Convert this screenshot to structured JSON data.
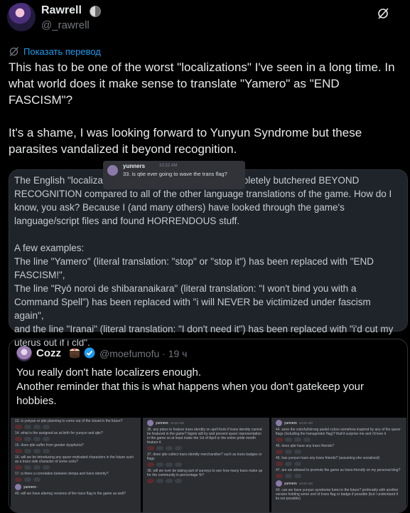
{
  "author": {
    "name": "Rawrell",
    "handle": "@_rawrell",
    "name_emoji_icon": "moon-icon"
  },
  "icons": {
    "top_right": "grok-slash-icon",
    "translate": "grok-icon"
  },
  "translate_link": "Показать перевод",
  "tweet_text": "This has to be one of the worst \"localizations\" I've seen in a long time. In what world does it make sense to translate \"Yamero\" as \"END FASCISM\"?\n\nIt's a shame, I was looking forward to Yunyun Syndrome but these parasites vandalized it beyond recognition.",
  "screenshot_text": "The English \"localization\" for this game has been completely butchered BEYOND RECOGNITION compared to all of the other language translations of the game. How do I know, you ask? Because I (and many others) have looked through the game's language/script files and found HORRENDOUS stuff.\n\nA few examples:\nThe line \"Yamero\" (literal translation: \"stop\" or \"stop it\") has been replaced with \"END FASCISM!\",\nThe line \"Ryō noroi de shibaranaikara\" (literal translation: \"I won't bind you with a Command Spell\") has been replaced with \"i will NEVER be victimized under fascism again\",\nand the line \"Iranai\" (literal translation: \"I don't need it\") has been replaced with \"i'd cut my uterus out if i cld\".",
  "quote": {
    "name": "Cozz",
    "handle_time": "@moefumofu · 19 ч",
    "text": "You really don't hate localizers enough.\nAnother reminder that this is what happens when you don't gatekeep your hobbies.",
    "name_emoji_icon": "cake-icon",
    "badge_icon": "verified-badge-icon"
  },
  "media": {
    "panel1": {
      "messages": [
        "13. is yunyun or qtie planning to come out of the closet in the future?",
        "14. what is the assigned as at birth for yunyun and qtie?",
        "15. does qtie suffer from gender dysphoria?",
        "16. will we be introducing any queer motivated characters in the future such as a trans side character of some sorts?",
        "17. is there a correlation between denpa and trans identity?"
      ],
      "trailing": "yunners ·",
      "trailing_msg": "40. will we have altering versions of the trans flag in the game as well?"
    },
    "panel2": {
      "poster": "yunners",
      "time": "10:22 AM",
      "messages": [
        "36. any plans to feature trans identity on april fools if trans identity cannot be featured in the game? bigots will try and prevent queer representation in the game so at least make the 1st of April or the entire pride month feature it",
        "37. does qtie collect trans identity merchandise? such as trans badges or flags",
        "38. will we ever be taking part of surveys to see how many trans make up for the community in percentage %?"
      ]
    },
    "panel3": {
      "poster": "yunners",
      "time": "10:22 AM",
      "messages": [
        "44. were the colorful/strong pastel colors somehow inspired by any of the queer flags (including the transgender flag)? that'd surprise me and i'd love it",
        "45. does qtie have any trans friends?",
        "46. has yunyun have any trans friends? (assuming she socialized)",
        "47. are we allowed to promote the game as trans-friendly on my personal blog?"
      ],
      "trailing_poster": "yunners",
      "trailing_time": "10:22 AM",
      "trailing_msg": "43. can we have yunyun syndrome fumo in the future? preferably with another version holding some sort of trans flag or badge if possible (but i understand if its not possible)"
    },
    "overlay": {
      "name": "yunners",
      "time": "10:22 AM",
      "text": "33. is qtie ever going to wave the trans flag?"
    }
  }
}
